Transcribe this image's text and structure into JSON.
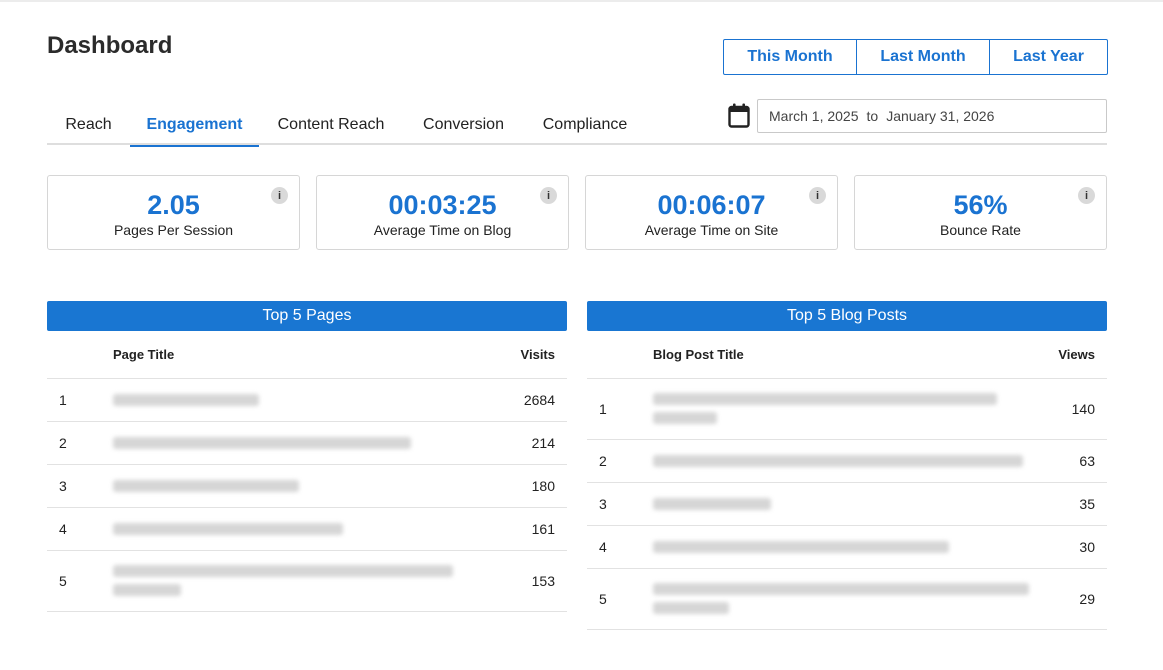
{
  "header": {
    "title": "Dashboard",
    "range_buttons": [
      "This Month",
      "Last Month",
      "Last Year"
    ]
  },
  "tabs": [
    "Reach",
    "Engagement",
    "Content Reach",
    "Conversion",
    "Compliance"
  ],
  "active_tab": "Engagement",
  "date_range": {
    "from": "March 1, 2025",
    "separator": "to",
    "to": "January 31, 2026",
    "icon": "calendar-icon"
  },
  "kpis": [
    {
      "value": "2.05",
      "label": "Pages Per Session",
      "info": "i"
    },
    {
      "value": "00:03:25",
      "label": "Average Time on Blog",
      "info": "i"
    },
    {
      "value": "00:06:07",
      "label": "Average Time on Site",
      "info": "i"
    },
    {
      "value": "56%",
      "label": "Bounce Rate",
      "info": "i"
    }
  ],
  "top_pages": {
    "title": "Top 5 Pages",
    "columns": [
      "Page Title",
      "Visits"
    ],
    "rows": [
      {
        "rank": "1",
        "value": "2684"
      },
      {
        "rank": "2",
        "value": "214"
      },
      {
        "rank": "3",
        "value": "180"
      },
      {
        "rank": "4",
        "value": "161"
      },
      {
        "rank": "5",
        "value": "153"
      }
    ]
  },
  "top_posts": {
    "title": "Top 5 Blog Posts",
    "columns": [
      "Blog Post Title",
      "Views"
    ],
    "rows": [
      {
        "rank": "1",
        "value": "140"
      },
      {
        "rank": "2",
        "value": "63"
      },
      {
        "rank": "3",
        "value": "35"
      },
      {
        "rank": "4",
        "value": "30"
      },
      {
        "rank": "5",
        "value": "29"
      }
    ]
  },
  "colors": {
    "accent": "#1a73d1",
    "header_bar": "#1976d2",
    "border": "#d6d6d6",
    "info_bg": "#d9d9d9"
  }
}
